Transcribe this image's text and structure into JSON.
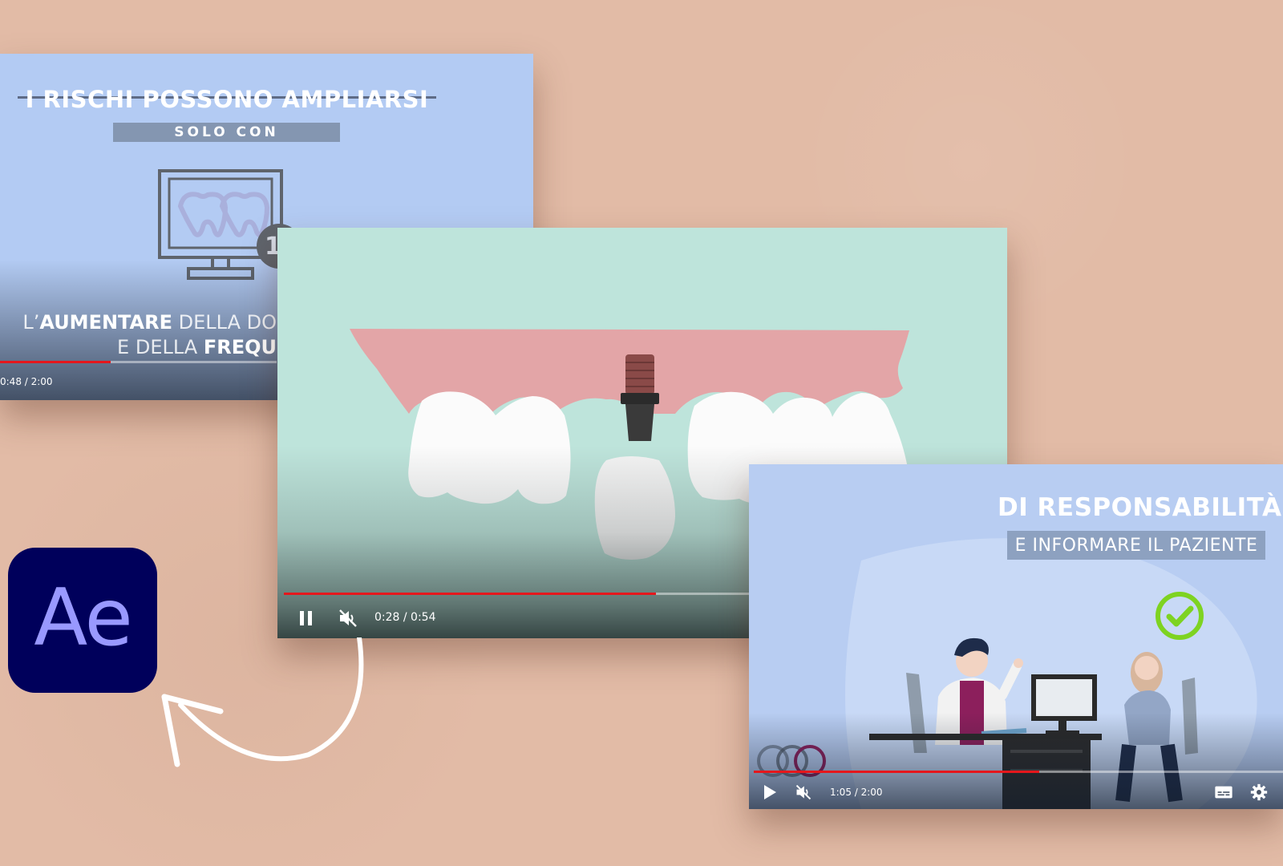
{
  "left_video": {
    "title": "I RISCHI POSSONO AMPLIARSI",
    "subtitle": "SOLO CON",
    "caption_line1_light": "L’",
    "caption_line1_bold": "AUMENTARE",
    "caption_line1_rest": " DELLA DO",
    "caption_line2_light": "E DELLA ",
    "caption_line2_bold": "FREQU",
    "badge_text": "1",
    "time": "0:48 / 2:00",
    "progress": 0.4
  },
  "main_video": {
    "time": "0:28 / 0:54",
    "progress": 0.519,
    "state": "playing",
    "muted": true,
    "colors": {
      "background": "#bee4db",
      "gum": "#e3a5a7",
      "tooth": "#fbfbfb",
      "implant": "#3a3a3a"
    }
  },
  "right_video": {
    "title": "DI RESPONSABILITÀ",
    "subtitle": "E INFORMARE IL PAZIENTE",
    "time": "1:05 / 2:00",
    "progress": 0.54,
    "state": "paused",
    "muted": true
  },
  "app_logo": {
    "text": "Ae",
    "bg": "#00005b",
    "fg": "#9999ff"
  },
  "colors": {
    "backdrop": "#e2bba6",
    "progress_red": "#e5171c",
    "check_green": "#7ed321"
  }
}
